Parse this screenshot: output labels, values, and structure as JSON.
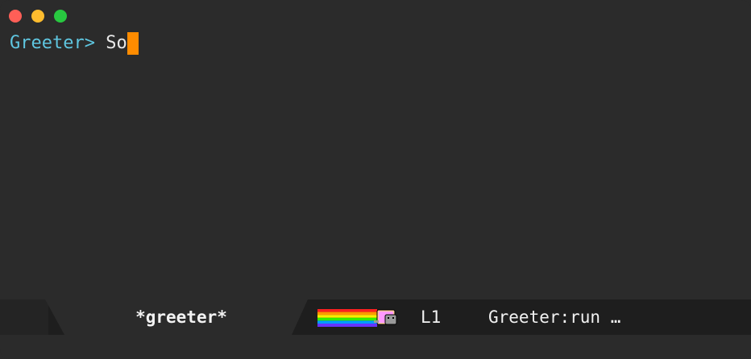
{
  "window": {
    "controls": [
      "close",
      "minimize",
      "maximize"
    ]
  },
  "repl": {
    "prompt": "Greeter>",
    "input": "So"
  },
  "modeline": {
    "buffer_name": "*greeter*",
    "line": "L1",
    "function": "Greeter:run …",
    "progress_icon": "nyan-cat-icon"
  },
  "colors": {
    "background": "#2b2b2b",
    "prompt": "#5fc6e0",
    "cursor": "#ff8c00",
    "modeline": "#1e1e1e"
  }
}
